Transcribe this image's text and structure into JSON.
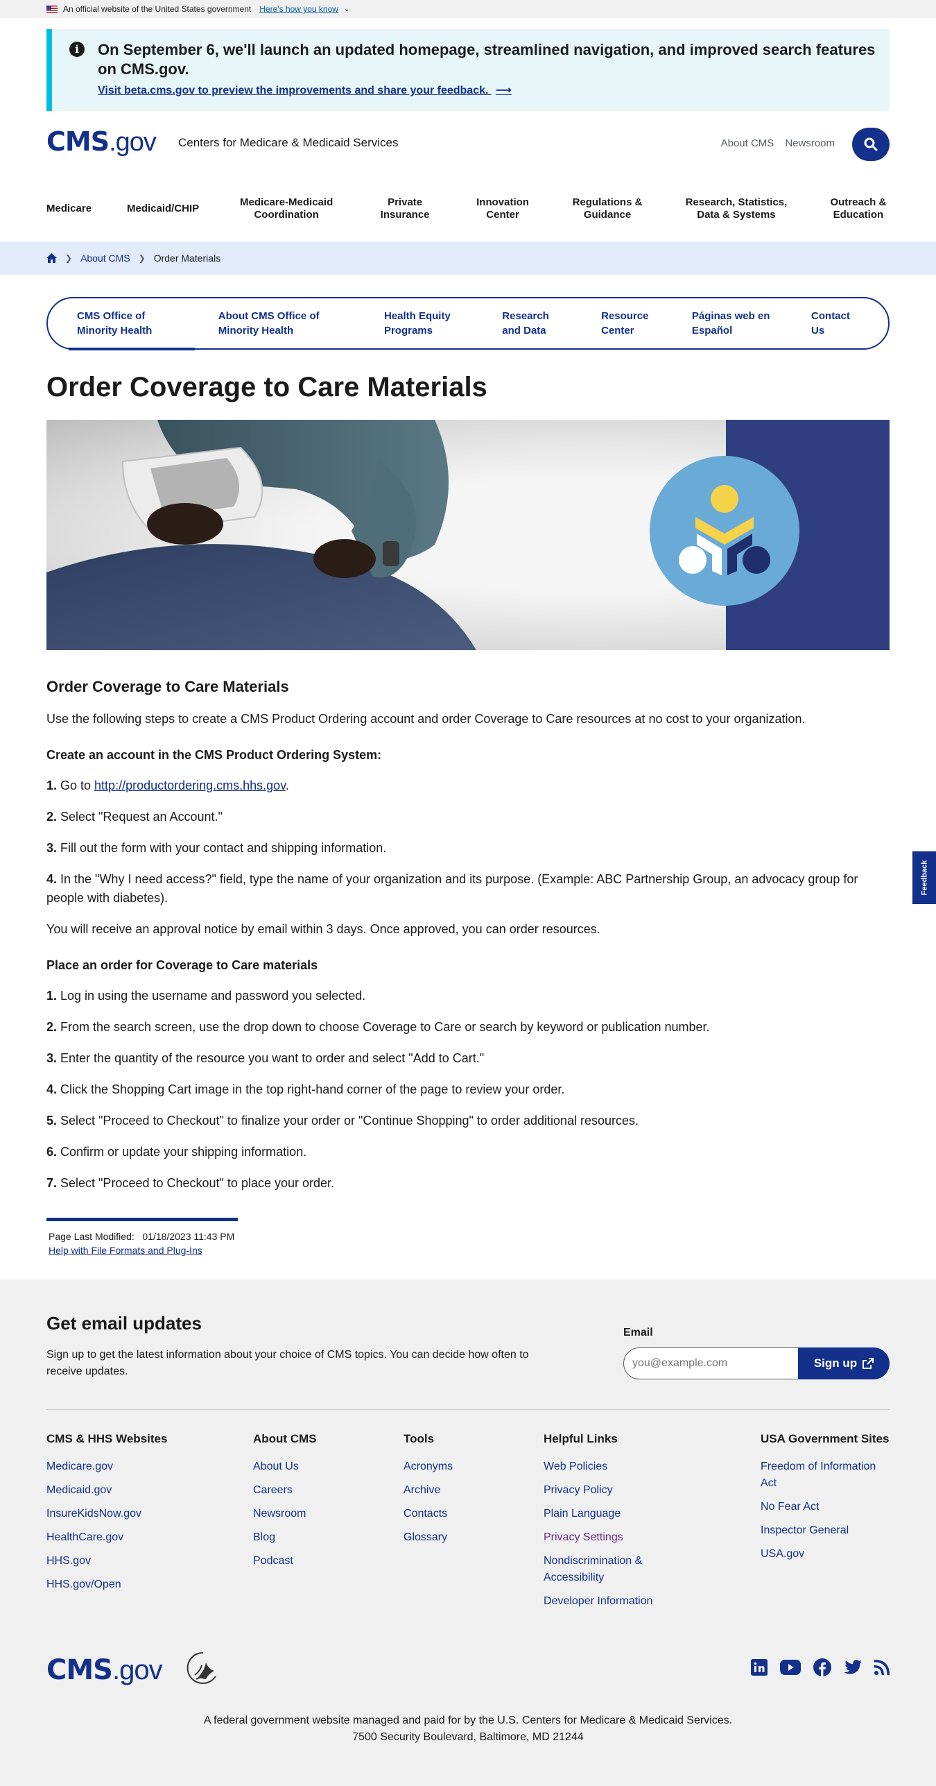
{
  "gov_banner": {
    "text": "An official website of the United States government",
    "link": "Here's how you know"
  },
  "alert": {
    "message": "On September 6, we'll launch an updated homepage, streamlined navigation, and improved search features on CMS.gov.",
    "cta": "Visit beta.cms.gov to preview the improvements and share your feedback."
  },
  "header": {
    "logo_cms": "CMS",
    "logo_gov": ".gov",
    "org_name": "Centers for Medicare & Medicaid Services",
    "util_links": [
      "About CMS",
      "Newsroom"
    ]
  },
  "main_nav": [
    "Medicare",
    "Medicaid/CHIP",
    "Medicare-Medicaid Coordination",
    "Private Insurance",
    "Innovation Center",
    "Regulations & Guidance",
    "Research, Statistics, Data & Systems",
    "Outreach & Education"
  ],
  "breadcrumbs": {
    "about": "About CMS",
    "current": "Order Materials"
  },
  "subnav": [
    "CMS Office of Minority Health",
    "About CMS Office of Minority Health",
    "Health Equity Programs",
    "Research and Data",
    "Resource Center",
    "Páginas web en Español",
    "Contact Us"
  ],
  "page": {
    "title": "Order Coverage to Care Materials",
    "section_title": "Order Coverage to Care Materials",
    "intro": "Use the following steps to create a CMS Product Ordering account and order Coverage to Care resources at no cost to your organization.",
    "account_heading": "Create an account in the CMS Product Ordering System:",
    "account_steps": [
      {
        "n": "1.",
        "pre": " Go to ",
        "link": "http://productordering.cms.hhs.gov",
        "post": "."
      },
      {
        "n": "2.",
        "text": " Select \"Request an Account.\""
      },
      {
        "n": "3.",
        "text": " Fill out the form with your contact and shipping information."
      },
      {
        "n": "4.",
        "text": " In the \"Why I need access?\" field, type the name of your organization and its purpose. (Example: ABC Partnership Group, an advocacy group for people with diabetes)."
      }
    ],
    "approval_note": "You will receive an approval notice by email within 3 days. Once approved, you can order resources.",
    "order_heading": "Place an order for Coverage to Care materials",
    "order_steps": [
      {
        "n": "1.",
        "text": " Log in using the username and password you selected."
      },
      {
        "n": "2.",
        "text": " From the search screen, use the drop down to choose Coverage to Care or search by keyword or publication number."
      },
      {
        "n": "3.",
        "text": " Enter the quantity of the resource you want to order and select \"Add to Cart.\""
      },
      {
        "n": "4.",
        "text": " Click the Shopping Cart image in the top right-hand corner of the page to review your order."
      },
      {
        "n": "5.",
        "text": " Select \"Proceed to Checkout\" to finalize your order or \"Continue Shopping\" to order additional resources."
      },
      {
        "n": "6.",
        "text": " Confirm or update your shipping information."
      },
      {
        "n": "7.",
        "text": " Select \"Proceed to Checkout\" to place your order."
      }
    ],
    "last_modified_label": "Page Last Modified:",
    "last_modified_value": "01/18/2023 11:43 PM",
    "help_link": "Help with File Formats and Plug-Ins"
  },
  "footer": {
    "email_title": "Get email updates",
    "email_text": "Sign up to get the latest information about your choice of CMS topics. You can decide how often to receive updates.",
    "email_label": "Email",
    "email_placeholder": "you@example.com",
    "signup_label": "Sign up",
    "columns": [
      {
        "title": "CMS & HHS Websites",
        "links": [
          "Medicare.gov",
          "Medicaid.gov",
          "InsureKidsNow.gov",
          "HealthCare.gov",
          "HHS.gov",
          "HHS.gov/Open"
        ]
      },
      {
        "title": "About CMS",
        "links": [
          "About Us",
          "Careers",
          "Newsroom",
          "Blog",
          "Podcast"
        ]
      },
      {
        "title": "Tools",
        "links": [
          "Acronyms",
          "Archive",
          "Contacts",
          "Glossary"
        ]
      },
      {
        "title": "Helpful Links",
        "links": [
          "Web Policies",
          "Privacy Policy",
          "Plain Language",
          "Privacy Settings",
          "Nondiscrimination & Accessibility",
          "Developer Information"
        ]
      },
      {
        "title": "USA Government Sites",
        "links": [
          "Freedom of Information Act",
          "No Fear Act",
          "Inspector General",
          "USA.gov"
        ]
      }
    ],
    "logo_cms": "CMS",
    "logo_gov": ".gov",
    "note_line1": "A federal government website managed and paid for by the U.S. Centers for Medicare & Medicaid Services.",
    "note_line2": "7500 Security Boulevard, Baltimore, MD 21244"
  },
  "feedback_label": "Feedback",
  "colors": {
    "brand_blue": "#13308a",
    "alert_bg": "#e7f6f8",
    "alert_border": "#00bde3",
    "breadcrumb_bg": "#e1ebf9",
    "footer_bg": "#f0f0f0",
    "hero_panel": "#2e3e7e",
    "visited_link": "#6c2f8c"
  },
  "icons": {
    "info": "info-circle-icon",
    "arrow": "arrow-right-icon",
    "search": "search-icon",
    "home": "home-icon",
    "external": "external-link-icon",
    "social": [
      "linkedin-icon",
      "youtube-icon",
      "facebook-icon",
      "twitter-icon",
      "rss-icon"
    ]
  }
}
